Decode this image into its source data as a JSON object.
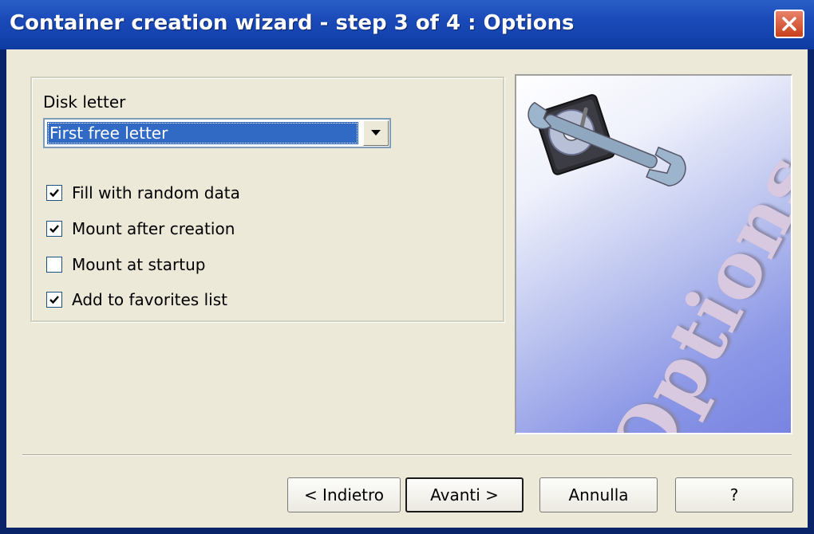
{
  "window": {
    "title": "Container creation wizard - step 3 of 4 : Options",
    "close_icon": "close-icon"
  },
  "options_group": {
    "disk_letter_label": "Disk letter",
    "disk_letter_value": "First free letter",
    "checkboxes": [
      {
        "label": "Fill with random data",
        "checked": true
      },
      {
        "label": "Mount after creation",
        "checked": true
      },
      {
        "label": "Mount at startup",
        "checked": false
      },
      {
        "label": "Add to favorites list",
        "checked": true
      }
    ]
  },
  "side_image": {
    "text": "Options",
    "icons": [
      "hard-disk-icon",
      "wrench-icon"
    ]
  },
  "buttons": {
    "back": "< Indietro",
    "next": "Avanti >",
    "cancel": "Annulla",
    "help": "?"
  },
  "colors": {
    "titlebar": "#1544b0",
    "selection": "#316ac5",
    "dialog_bg": "#ece9d8"
  }
}
